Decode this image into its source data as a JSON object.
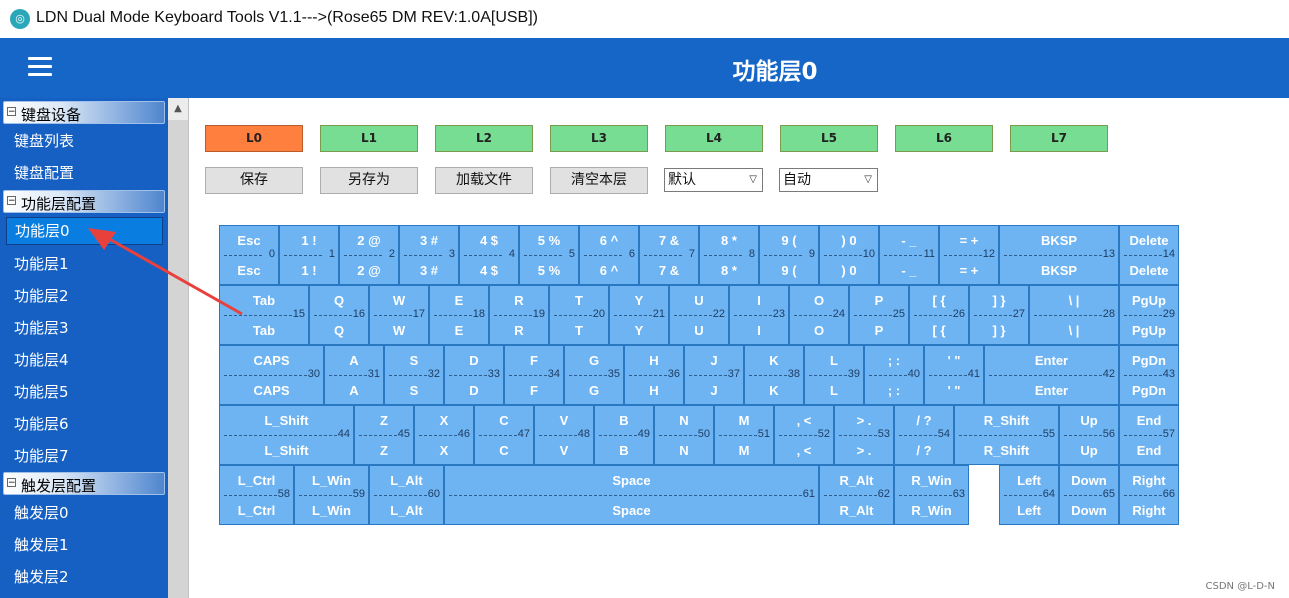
{
  "window": {
    "title": "LDN Dual Mode Keyboard Tools V1.1--->(Rose65 DM REV:1.0A[USB])"
  },
  "header": {
    "title": "功能层0"
  },
  "sidebar": {
    "groups": [
      {
        "label": "键盘设备",
        "toggle": "−",
        "items": [
          "键盘列表",
          "键盘配置"
        ]
      },
      {
        "label": "功能层配置",
        "toggle": "−",
        "items": [
          "功能层0",
          "功能层1",
          "功能层2",
          "功能层3",
          "功能层4",
          "功能层5",
          "功能层6",
          "功能层7"
        ]
      },
      {
        "label": "触发层配置",
        "toggle": "−",
        "items": [
          "触发层0",
          "触发层1",
          "触发层2"
        ]
      }
    ],
    "selected_item": "功能层0"
  },
  "layers": {
    "buttons": [
      "L0",
      "L1",
      "L2",
      "L3",
      "L4",
      "L5",
      "L6",
      "L7"
    ],
    "active": "L0"
  },
  "actions": {
    "save": "保存",
    "save_as": "另存为",
    "load_file": "加载文件",
    "clear_layer": "清空本层",
    "mode_select": "默认",
    "auto_select": "自动"
  },
  "keyboard": {
    "keys": [
      {
        "top": "Esc",
        "bottom": "Esc",
        "index": "0"
      },
      {
        "top": "1 !",
        "bottom": "1 !",
        "index": "1"
      },
      {
        "top": "2 @",
        "bottom": "2 @",
        "index": "2"
      },
      {
        "top": "3 #",
        "bottom": "3 #",
        "index": "3"
      },
      {
        "top": "4 $",
        "bottom": "4 $",
        "index": "4"
      },
      {
        "top": "5 %",
        "bottom": "5 %",
        "index": "5"
      },
      {
        "top": "6 ^",
        "bottom": "6 ^",
        "index": "6"
      },
      {
        "top": "7 &",
        "bottom": "7 &",
        "index": "7"
      },
      {
        "top": "8 *",
        "bottom": "8 *",
        "index": "8"
      },
      {
        "top": "9 (",
        "bottom": "9 (",
        "index": "9"
      },
      {
        "top": ") 0",
        "bottom": ") 0",
        "index": "10"
      },
      {
        "top": "- _",
        "bottom": "- _",
        "index": "11"
      },
      {
        "top": "= +",
        "bottom": "= +",
        "index": "12"
      },
      {
        "top": "BKSP",
        "bottom": "BKSP",
        "index": "13"
      },
      {
        "top": "Delete",
        "bottom": "Delete",
        "index": "14"
      },
      {
        "top": "Tab",
        "bottom": "Tab",
        "index": "15"
      },
      {
        "top": "Q",
        "bottom": "Q",
        "index": "16"
      },
      {
        "top": "W",
        "bottom": "W",
        "index": "17"
      },
      {
        "top": "E",
        "bottom": "E",
        "index": "18"
      },
      {
        "top": "R",
        "bottom": "R",
        "index": "19"
      },
      {
        "top": "T",
        "bottom": "T",
        "index": "20"
      },
      {
        "top": "Y",
        "bottom": "Y",
        "index": "21"
      },
      {
        "top": "U",
        "bottom": "U",
        "index": "22"
      },
      {
        "top": "I",
        "bottom": "I",
        "index": "23"
      },
      {
        "top": "O",
        "bottom": "O",
        "index": "24"
      },
      {
        "top": "P",
        "bottom": "P",
        "index": "25"
      },
      {
        "top": "[ {",
        "bottom": "[ {",
        "index": "26"
      },
      {
        "top": "] }",
        "bottom": "] }",
        "index": "27"
      },
      {
        "top": "\\ |",
        "bottom": "\\ |",
        "index": "28"
      },
      {
        "top": "PgUp",
        "bottom": "PgUp",
        "index": "29"
      },
      {
        "top": "CAPS",
        "bottom": "CAPS",
        "index": "30"
      },
      {
        "top": "A",
        "bottom": "A",
        "index": "31"
      },
      {
        "top": "S",
        "bottom": "S",
        "index": "32"
      },
      {
        "top": "D",
        "bottom": "D",
        "index": "33"
      },
      {
        "top": "F",
        "bottom": "F",
        "index": "34"
      },
      {
        "top": "G",
        "bottom": "G",
        "index": "35"
      },
      {
        "top": "H",
        "bottom": "H",
        "index": "36"
      },
      {
        "top": "J",
        "bottom": "J",
        "index": "37"
      },
      {
        "top": "K",
        "bottom": "K",
        "index": "38"
      },
      {
        "top": "L",
        "bottom": "L",
        "index": "39"
      },
      {
        "top": "; :",
        "bottom": "; :",
        "index": "40"
      },
      {
        "top": "' \"",
        "bottom": "' \"",
        "index": "41"
      },
      {
        "top": "Enter",
        "bottom": "Enter",
        "index": "42"
      },
      {
        "top": "PgDn",
        "bottom": "PgDn",
        "index": "43"
      },
      {
        "top": "L_Shift",
        "bottom": "L_Shift",
        "index": "44"
      },
      {
        "top": "Z",
        "bottom": "Z",
        "index": "45"
      },
      {
        "top": "X",
        "bottom": "X",
        "index": "46"
      },
      {
        "top": "C",
        "bottom": "C",
        "index": "47"
      },
      {
        "top": "V",
        "bottom": "V",
        "index": "48"
      },
      {
        "top": "B",
        "bottom": "B",
        "index": "49"
      },
      {
        "top": "N",
        "bottom": "N",
        "index": "50"
      },
      {
        "top": "M",
        "bottom": "M",
        "index": "51"
      },
      {
        "top": ", <",
        "bottom": ", <",
        "index": "52"
      },
      {
        "top": "> .",
        "bottom": "> .",
        "index": "53"
      },
      {
        "top": "/ ?",
        "bottom": "/ ?",
        "index": "54"
      },
      {
        "top": "R_Shift",
        "bottom": "R_Shift",
        "index": "55"
      },
      {
        "top": "Up",
        "bottom": "Up",
        "index": "56"
      },
      {
        "top": "End",
        "bottom": "End",
        "index": "57"
      },
      {
        "top": "L_Ctrl",
        "bottom": "L_Ctrl",
        "index": "58"
      },
      {
        "top": "L_Win",
        "bottom": "L_Win",
        "index": "59"
      },
      {
        "top": "L_Alt",
        "bottom": "L_Alt",
        "index": "60"
      },
      {
        "top": "Space",
        "bottom": "Space",
        "index": "61"
      },
      {
        "top": "R_Alt",
        "bottom": "R_Alt",
        "index": "62"
      },
      {
        "top": "R_Win",
        "bottom": "R_Win",
        "index": "63"
      },
      {
        "top": "Left",
        "bottom": "Left",
        "index": "64"
      },
      {
        "top": "Down",
        "bottom": "Down",
        "index": "65"
      },
      {
        "top": "Right",
        "bottom": "Right",
        "index": "66"
      }
    ]
  },
  "watermark": "CSDN @L-D-N",
  "colors": {
    "header_bg": "#1666c8",
    "sidebar_bg": "#1660c3",
    "layer_active": "#ff7f3f",
    "layer_inactive": "#77dd93",
    "key_bg": "#6fb4f2",
    "annotation_arrow": "#e8403c"
  }
}
